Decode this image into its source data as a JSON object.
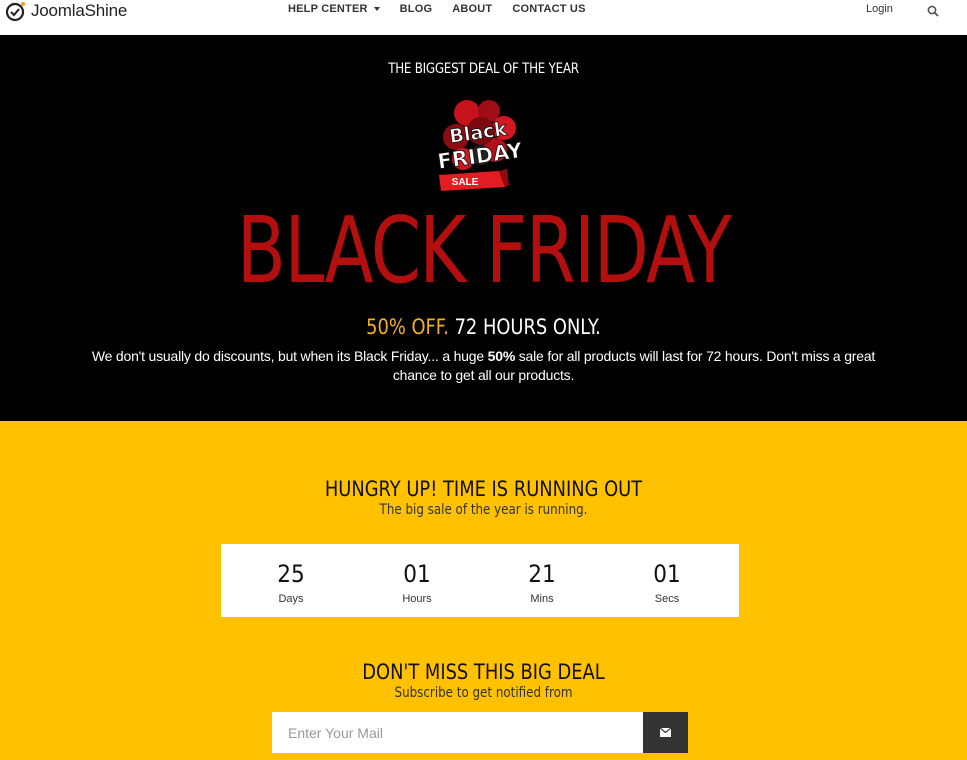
{
  "nav": {
    "logo_text": "JoomlaShine",
    "items": [
      {
        "label": "HELP CENTER",
        "has_dropdown": true
      },
      {
        "label": "BLOG"
      },
      {
        "label": "ABOUT"
      },
      {
        "label": "CONTACT US"
      }
    ],
    "login_label": "Login",
    "search_icon": "search-icon"
  },
  "hero": {
    "eyebrow": "THE BIGGEST DEAL OF THE YEAR",
    "badge": {
      "line1": "Black",
      "line2": "FRIDAY",
      "line3": "SALE"
    },
    "headline": "BLACK FRIDAY",
    "offer_highlight": "50% OFF.",
    "offer_rest": " 72 HOURS ONLY.",
    "desc_part1": "We don't usually do discounts, but when its Black Friday... a huge ",
    "desc_bold": "50%",
    "desc_part2": " sale for all products will last for 72 hours. Don't miss a great chance to get all our products.",
    "colors": {
      "headline": "#b30f0f",
      "highlight": "#f2b01f",
      "background": "#000000"
    }
  },
  "promo": {
    "title": "HUNGRY UP! TIME IS RUNNING OUT",
    "subtitle": "The big sale of the year is running.",
    "countdown": [
      {
        "value": "25",
        "label": "Days"
      },
      {
        "value": "01",
        "label": "Hours"
      },
      {
        "value": "21",
        "label": "Mins"
      },
      {
        "value": "01",
        "label": "Secs"
      }
    ],
    "deal_title": "DON'T MISS THIS BIG DEAL",
    "deal_subtitle": "Subscribe to get notified from",
    "email_placeholder": "Enter Your Mail",
    "submit_icon": "envelope-icon",
    "colors": {
      "background": "#ffc100",
      "button": "#333333"
    }
  }
}
